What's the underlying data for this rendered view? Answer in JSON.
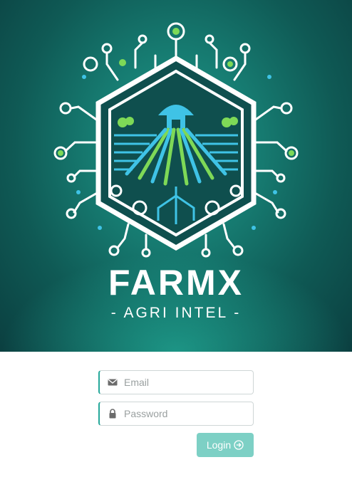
{
  "brand": {
    "title": "FARMX",
    "subtitle": "- AGRI  INTEL -"
  },
  "colors": {
    "accent": "#26a89a",
    "button": "#7dd0c5",
    "logo_green": "#7ed957",
    "logo_blue": "#3fc3e6"
  },
  "login_form": {
    "email": {
      "placeholder": "Email",
      "value": "",
      "icon": "envelope-icon"
    },
    "password": {
      "placeholder": "Password",
      "value": "",
      "icon": "lock-icon"
    },
    "login_label": "Login",
    "login_icon": "arrow-circle-right-icon"
  }
}
